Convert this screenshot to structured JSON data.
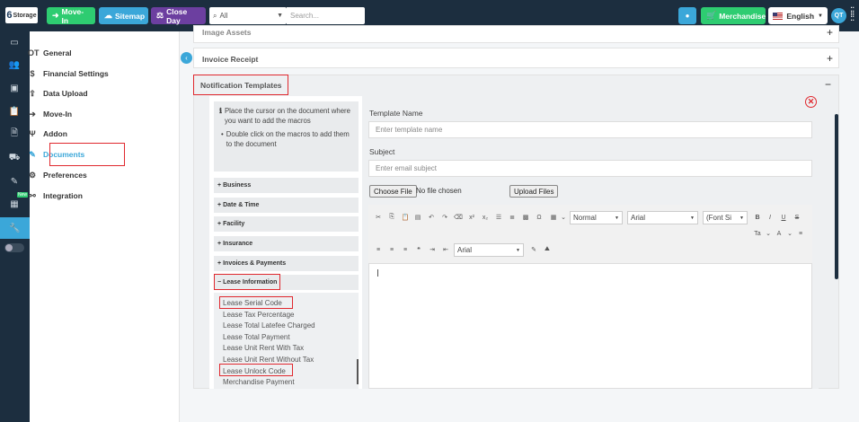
{
  "topbar": {
    "logo": {
      "mark": "6",
      "text": "Storage"
    },
    "move_in": "Move-In",
    "sitemap": "Sitemap",
    "close_day": "Close Day",
    "filter_value": "All",
    "search_placeholder": "Search...",
    "merchandise": "Merchandise",
    "language": "English",
    "user_initials": "QT"
  },
  "settings_menu": [
    {
      "label": "General",
      "icon": "sliders-icon"
    },
    {
      "label": "Financial Settings",
      "icon": "dollar-icon"
    },
    {
      "label": "Data Upload",
      "icon": "upload-icon"
    },
    {
      "label": "Move-In",
      "icon": "move-in-icon"
    },
    {
      "label": "Addon",
      "icon": "addon-icon"
    },
    {
      "label": "Documents",
      "icon": "edit-document-icon",
      "active": true
    },
    {
      "label": "Preferences",
      "icon": "gear-icon"
    },
    {
      "label": "Integration",
      "icon": "link-icon"
    }
  ],
  "rail_new_badge": "New",
  "panels": {
    "image_assets": "Image Assets",
    "invoice_receipt": "Invoice Receipt",
    "notification_templates": "Notification Templates"
  },
  "macros": {
    "instructions": [
      "Place the cursor on the document where you want to add the macros",
      "Double click on the macros to add them to the document"
    ],
    "groups": [
      "Business",
      "Date & Time",
      "Facility",
      "Insurance",
      "Invoices & Payments",
      "Lease Information"
    ],
    "lease_items": [
      "Lease Serial Code",
      "Lease Tax Percentage",
      "Lease Total Latefee Charged",
      "Lease Total Payment",
      "Lease Unit Rent With Tax",
      "Lease Unit Rent Without Tax",
      "Lease Unlock Code",
      "Merchandise Payment"
    ]
  },
  "form": {
    "template_name_label": "Template Name",
    "template_name_placeholder": "Enter template name",
    "subject_label": "Subject",
    "subject_placeholder": "Enter email subject",
    "choose_file": "Choose File",
    "no_file": "No file chosen",
    "upload_files": "Upload Files"
  },
  "editor": {
    "format": "Normal",
    "font": "Arial",
    "font_size": "(Font Si",
    "font2": "Arial"
  },
  "colors": {
    "topbar": "#1c2e3f",
    "green": "#2ecc71",
    "blue": "#3ba7d9",
    "purple": "#6c3fa0",
    "highlight": "#e0282e"
  }
}
